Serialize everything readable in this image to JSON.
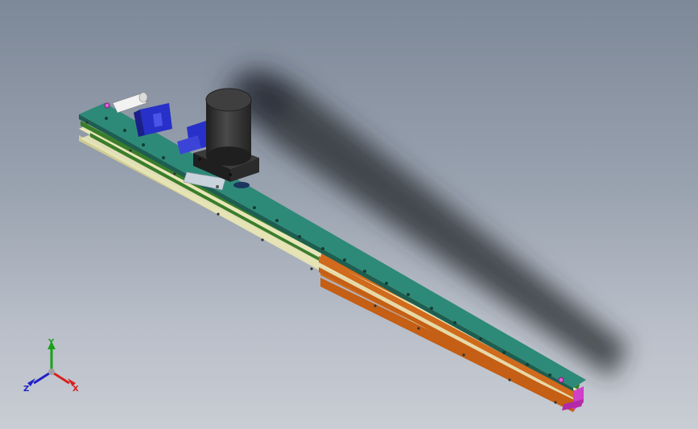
{
  "viewport": {
    "background_top": "#7d8898",
    "background_bottom": "#c9cdd4"
  },
  "model": {
    "name_icon": "linear-module-model",
    "colors": {
      "rail_top": "#2e8a78",
      "rail_edge": "#1d5e52",
      "rail_cream": "#e8e6b8",
      "rail_green_stripe": "#3a7d2a",
      "rail_orange": "#d06a1c",
      "motor_body": "#3a3a3a",
      "motor_base": "#2b2b2b",
      "bracket_blue": "#2730c8",
      "plate_silver": "#c9d3dc",
      "end_magenta": "#d040c8"
    }
  },
  "triad": {
    "x_label": "X",
    "y_label": "Y",
    "z_label": "Z",
    "x_color": "#d62020",
    "y_color": "#1aa01a",
    "z_color": "#2020c8"
  }
}
